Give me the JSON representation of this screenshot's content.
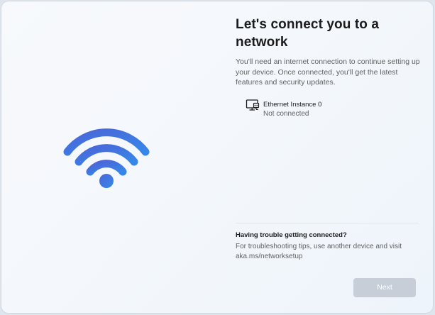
{
  "page": {
    "title": "Let's connect you to a network",
    "description": "You'll need an internet connection to continue setting up your device. Once connected, you'll get the latest features and security updates."
  },
  "networks": [
    {
      "name": "Ethernet Instance 0",
      "status": "Not connected",
      "icon": "ethernet-monitor-icon"
    }
  ],
  "help": {
    "title": "Having trouble getting connected?",
    "text": "For troubleshooting tips, use another device and visit aka.ms/networksetup"
  },
  "actions": {
    "next_label": "Next"
  },
  "illustration": {
    "icon": "wifi-icon",
    "colors": {
      "outer": "#3e73de",
      "middle": "#3d78e0",
      "inner": "#3b80e6",
      "dot": "#3576dc"
    }
  },
  "colors": {
    "title": "#1b1b1b",
    "body": "#616161",
    "button_disabled": "#c7ced7"
  }
}
